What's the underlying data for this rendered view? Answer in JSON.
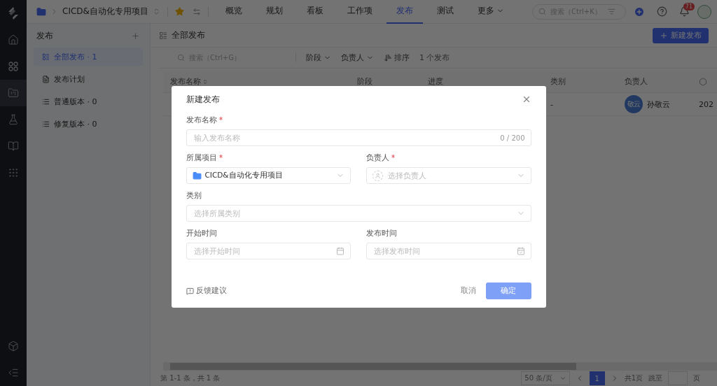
{
  "rail": {
    "items": [
      {
        "selected": false
      },
      {
        "selected": false
      },
      {
        "selected": true
      },
      {
        "selected": false
      },
      {
        "selected": false
      },
      {
        "selected": false
      }
    ]
  },
  "topbar": {
    "project": "CICD&自动化专用项目",
    "tabs": [
      {
        "label": "概览",
        "selected": false
      },
      {
        "label": "规划",
        "selected": false
      },
      {
        "label": "看板",
        "selected": false
      },
      {
        "label": "工作项",
        "selected": false
      },
      {
        "label": "发布",
        "selected": true
      },
      {
        "label": "测试",
        "selected": false
      },
      {
        "label": "更多",
        "selected": false
      }
    ],
    "search": {
      "placeholder": "搜索（Ctrl+K）"
    },
    "notification_count": "71"
  },
  "sidebar": {
    "title": "发布",
    "items": [
      {
        "label": "全部发布 · 1",
        "selected": true
      },
      {
        "label": "发布计划",
        "selected": false
      },
      {
        "label": "普通版本 · 0",
        "selected": false
      },
      {
        "label": "修复版本 · 0",
        "selected": false
      }
    ]
  },
  "main": {
    "title": "全部发布",
    "new_button": "新建发布",
    "filters": {
      "search_placeholder": "搜索（Ctrl+G）",
      "stage": "阶段",
      "owner": "负责人",
      "sort": "排序",
      "count": "1 个发布"
    },
    "table": {
      "columns": [
        "发布名称",
        "阶段",
        "进度",
        "类别",
        "负责人"
      ],
      "rows": [
        {
          "category": "-",
          "owner_avatar": "敬云",
          "owner": "孙敬云",
          "column_6": "202"
        }
      ]
    },
    "footer": {
      "summary": "第 1-1 条，共 1 条",
      "page_size": "50 条/页",
      "pages": [
        {
          "label": "1",
          "selected": true
        }
      ],
      "total_pages": "共1页",
      "jump_label": "跳至",
      "page_unit": "页"
    }
  },
  "modal": {
    "title": "新建发布",
    "rows": [
      {
        "fields": [
          {
            "kind": "text",
            "label": "发布名称",
            "required": true,
            "placeholder": "输入发布名称",
            "counter": "0 / 200"
          }
        ]
      },
      {
        "fields": [
          {
            "kind": "project",
            "label": "所属项目",
            "required": true,
            "value": "CICD&自动化专用项目"
          },
          {
            "kind": "person",
            "label": "负责人",
            "required": true,
            "placeholder": "选择负责人"
          }
        ]
      },
      {
        "fields": [
          {
            "kind": "select",
            "label": "类别",
            "required": false,
            "placeholder": "选择所属类别"
          }
        ]
      },
      {
        "fields": [
          {
            "kind": "date",
            "label": "开始时间",
            "required": false,
            "placeholder": "选择开始时间"
          },
          {
            "kind": "datecheck",
            "label": "发布时间",
            "required": false,
            "placeholder": "选择发布时间"
          }
        ]
      }
    ],
    "feedback": "反馈建议",
    "cancel": "取消",
    "confirm": {
      "label": "确定",
      "disabled": true
    }
  }
}
